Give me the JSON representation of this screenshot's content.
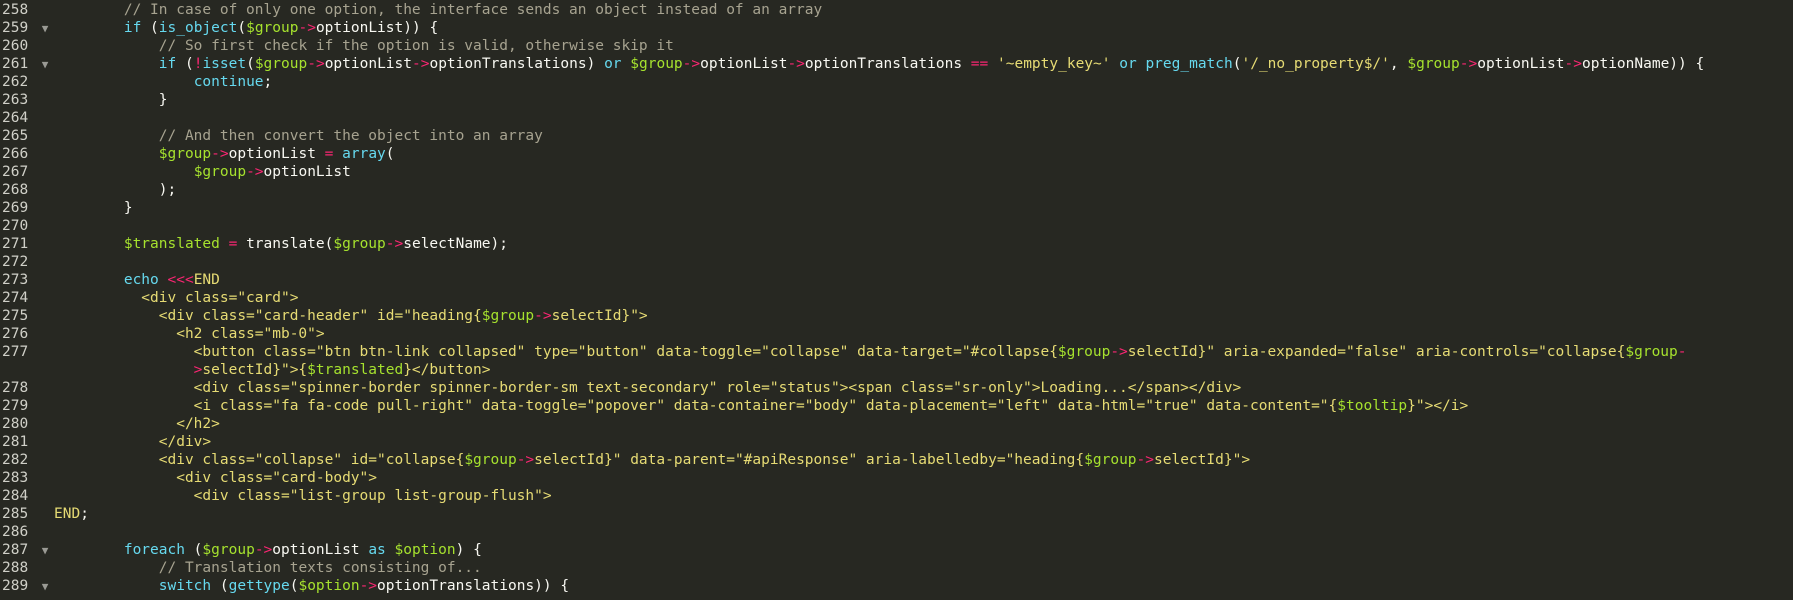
{
  "editor": {
    "lines": [
      {
        "num": "258",
        "fold": "",
        "tokens": [
          [
            "t",
            "        "
          ],
          [
            "c",
            "// In case of only one option, the interface sends an object instead of an array"
          ]
        ]
      },
      {
        "num": "259",
        "fold": "▼",
        "tokens": [
          [
            "t",
            "        "
          ],
          [
            "k",
            "if"
          ],
          [
            "t",
            " ("
          ],
          [
            "k",
            "is_object"
          ],
          [
            "t",
            "("
          ],
          [
            "v",
            "$group"
          ],
          [
            "o",
            "->"
          ],
          [
            "t",
            "optionList)) {"
          ]
        ]
      },
      {
        "num": "260",
        "fold": "",
        "tokens": [
          [
            "t",
            "            "
          ],
          [
            "c",
            "// So first check if the option is valid, otherwise skip it"
          ]
        ]
      },
      {
        "num": "261",
        "fold": "▼",
        "tokens": [
          [
            "t",
            "            "
          ],
          [
            "k",
            "if"
          ],
          [
            "t",
            " ("
          ],
          [
            "o",
            "!"
          ],
          [
            "k",
            "isset"
          ],
          [
            "t",
            "("
          ],
          [
            "v",
            "$group"
          ],
          [
            "o",
            "->"
          ],
          [
            "t",
            "optionList"
          ],
          [
            "o",
            "->"
          ],
          [
            "t",
            "optionTranslations) "
          ],
          [
            "k",
            "or"
          ],
          [
            "t",
            " "
          ],
          [
            "v",
            "$group"
          ],
          [
            "o",
            "->"
          ],
          [
            "t",
            "optionList"
          ],
          [
            "o",
            "->"
          ],
          [
            "t",
            "optionTranslations "
          ],
          [
            "o",
            "=="
          ],
          [
            "t",
            " "
          ],
          [
            "s",
            "'~empty_key~'"
          ],
          [
            "t",
            " "
          ],
          [
            "k",
            "or"
          ],
          [
            "t",
            " "
          ],
          [
            "k",
            "preg_match"
          ],
          [
            "t",
            "("
          ],
          [
            "s",
            "'/_no_property$/'"
          ],
          [
            "t",
            ", "
          ],
          [
            "v",
            "$group"
          ],
          [
            "o",
            "->"
          ],
          [
            "t",
            "optionList"
          ],
          [
            "o",
            "->"
          ],
          [
            "t",
            "optionName)) {"
          ]
        ]
      },
      {
        "num": "262",
        "fold": "",
        "tokens": [
          [
            "t",
            "                "
          ],
          [
            "k",
            "continue"
          ],
          [
            "t",
            ";"
          ]
        ]
      },
      {
        "num": "263",
        "fold": "",
        "tokens": [
          [
            "t",
            "            }"
          ]
        ]
      },
      {
        "num": "264",
        "fold": "",
        "tokens": [
          [
            "t",
            ""
          ]
        ]
      },
      {
        "num": "265",
        "fold": "",
        "tokens": [
          [
            "t",
            "            "
          ],
          [
            "c",
            "// And then convert the object into an array"
          ]
        ]
      },
      {
        "num": "266",
        "fold": "",
        "tokens": [
          [
            "t",
            "            "
          ],
          [
            "v",
            "$group"
          ],
          [
            "o",
            "->"
          ],
          [
            "t",
            "optionList "
          ],
          [
            "o",
            "="
          ],
          [
            "t",
            " "
          ],
          [
            "k",
            "array"
          ],
          [
            "t",
            "("
          ]
        ]
      },
      {
        "num": "267",
        "fold": "",
        "tokens": [
          [
            "t",
            "                "
          ],
          [
            "v",
            "$group"
          ],
          [
            "o",
            "->"
          ],
          [
            "t",
            "optionList"
          ]
        ]
      },
      {
        "num": "268",
        "fold": "",
        "tokens": [
          [
            "t",
            "            );"
          ]
        ]
      },
      {
        "num": "269",
        "fold": "",
        "tokens": [
          [
            "t",
            "        }"
          ]
        ]
      },
      {
        "num": "270",
        "fold": "",
        "tokens": [
          [
            "t",
            ""
          ]
        ]
      },
      {
        "num": "271",
        "fold": "",
        "tokens": [
          [
            "t",
            "        "
          ],
          [
            "v",
            "$translated"
          ],
          [
            "t",
            " "
          ],
          [
            "o",
            "="
          ],
          [
            "t",
            " translate("
          ],
          [
            "v",
            "$group"
          ],
          [
            "o",
            "->"
          ],
          [
            "t",
            "selectName);"
          ]
        ]
      },
      {
        "num": "272",
        "fold": "",
        "tokens": [
          [
            "t",
            ""
          ]
        ]
      },
      {
        "num": "273",
        "fold": "",
        "tokens": [
          [
            "t",
            "        "
          ],
          [
            "k",
            "echo"
          ],
          [
            "t",
            " "
          ],
          [
            "o",
            "<<<"
          ],
          [
            "h",
            "END"
          ]
        ]
      },
      {
        "num": "274",
        "fold": "",
        "tokens": [
          [
            "h",
            "          <div class=\"card\">"
          ]
        ]
      },
      {
        "num": "275",
        "fold": "",
        "tokens": [
          [
            "h",
            "            <div class=\"card-header\" id=\"heading{"
          ],
          [
            "v",
            "$group"
          ],
          [
            "o",
            "->"
          ],
          [
            "h",
            "selectId}\">"
          ]
        ]
      },
      {
        "num": "276",
        "fold": "",
        "tokens": [
          [
            "h",
            "              <h2 class=\"mb-0\">"
          ]
        ]
      },
      {
        "num": "277",
        "fold": "",
        "tokens": [
          [
            "h",
            "                <button class=\"btn btn-link collapsed\" type=\"button\" data-toggle=\"collapse\" data-target=\"#collapse{"
          ],
          [
            "v",
            "$group"
          ],
          [
            "o",
            "->"
          ],
          [
            "h",
            "selectId}\" aria-expanded=\"false\" aria-controls=\"collapse{"
          ],
          [
            "v",
            "$group"
          ],
          [
            "o",
            "-"
          ]
        ]
      },
      {
        "num": "",
        "fold": "",
        "tokens": [
          [
            "o",
            "                >"
          ],
          [
            "h",
            "selectId}\">{"
          ],
          [
            "v",
            "$translated"
          ],
          [
            "h",
            "}</button>"
          ]
        ]
      },
      {
        "num": "278",
        "fold": "",
        "tokens": [
          [
            "h",
            "                <div class=\"spinner-border spinner-border-sm text-secondary\" role=\"status\"><span class=\"sr-only\">Loading...</span></div>"
          ]
        ]
      },
      {
        "num": "279",
        "fold": "",
        "tokens": [
          [
            "h",
            "                <i class=\"fa fa-code pull-right\" data-toggle=\"popover\" data-container=\"body\" data-placement=\"left\" data-html=\"true\" data-content=\"{"
          ],
          [
            "v",
            "$tooltip"
          ],
          [
            "h",
            "}\"></i>"
          ]
        ]
      },
      {
        "num": "280",
        "fold": "",
        "tokens": [
          [
            "h",
            "              </h2>"
          ]
        ]
      },
      {
        "num": "281",
        "fold": "",
        "tokens": [
          [
            "h",
            "            </div>"
          ]
        ]
      },
      {
        "num": "282",
        "fold": "",
        "tokens": [
          [
            "h",
            "            <div class=\"collapse\" id=\"collapse{"
          ],
          [
            "v",
            "$group"
          ],
          [
            "o",
            "->"
          ],
          [
            "h",
            "selectId}\" data-parent=\"#apiResponse\" aria-labelledby=\"heading{"
          ],
          [
            "v",
            "$group"
          ],
          [
            "o",
            "->"
          ],
          [
            "h",
            "selectId}\">"
          ]
        ]
      },
      {
        "num": "283",
        "fold": "",
        "tokens": [
          [
            "h",
            "              <div class=\"card-body\">"
          ]
        ]
      },
      {
        "num": "284",
        "fold": "",
        "tokens": [
          [
            "h",
            "                <div class=\"list-group list-group-flush\">"
          ]
        ]
      },
      {
        "num": "285",
        "fold": "",
        "tokens": [
          [
            "h",
            "END"
          ],
          [
            "t",
            ";"
          ]
        ]
      },
      {
        "num": "286",
        "fold": "",
        "tokens": [
          [
            "t",
            ""
          ]
        ]
      },
      {
        "num": "287",
        "fold": "▼",
        "tokens": [
          [
            "t",
            "        "
          ],
          [
            "k",
            "foreach"
          ],
          [
            "t",
            " ("
          ],
          [
            "v",
            "$group"
          ],
          [
            "o",
            "->"
          ],
          [
            "t",
            "optionList "
          ],
          [
            "k",
            "as"
          ],
          [
            "t",
            " "
          ],
          [
            "v",
            "$option"
          ],
          [
            "t",
            ") {"
          ]
        ]
      },
      {
        "num": "288",
        "fold": "",
        "tokens": [
          [
            "t",
            "            "
          ],
          [
            "c",
            "// Translation texts consisting of..."
          ]
        ]
      },
      {
        "num": "289",
        "fold": "▼",
        "tokens": [
          [
            "t",
            "            "
          ],
          [
            "k",
            "switch"
          ],
          [
            "t",
            " ("
          ],
          [
            "k",
            "gettype"
          ],
          [
            "t",
            "("
          ],
          [
            "v",
            "$option"
          ],
          [
            "o",
            "->"
          ],
          [
            "t",
            "optionTranslations)) {"
          ]
        ]
      }
    ]
  }
}
